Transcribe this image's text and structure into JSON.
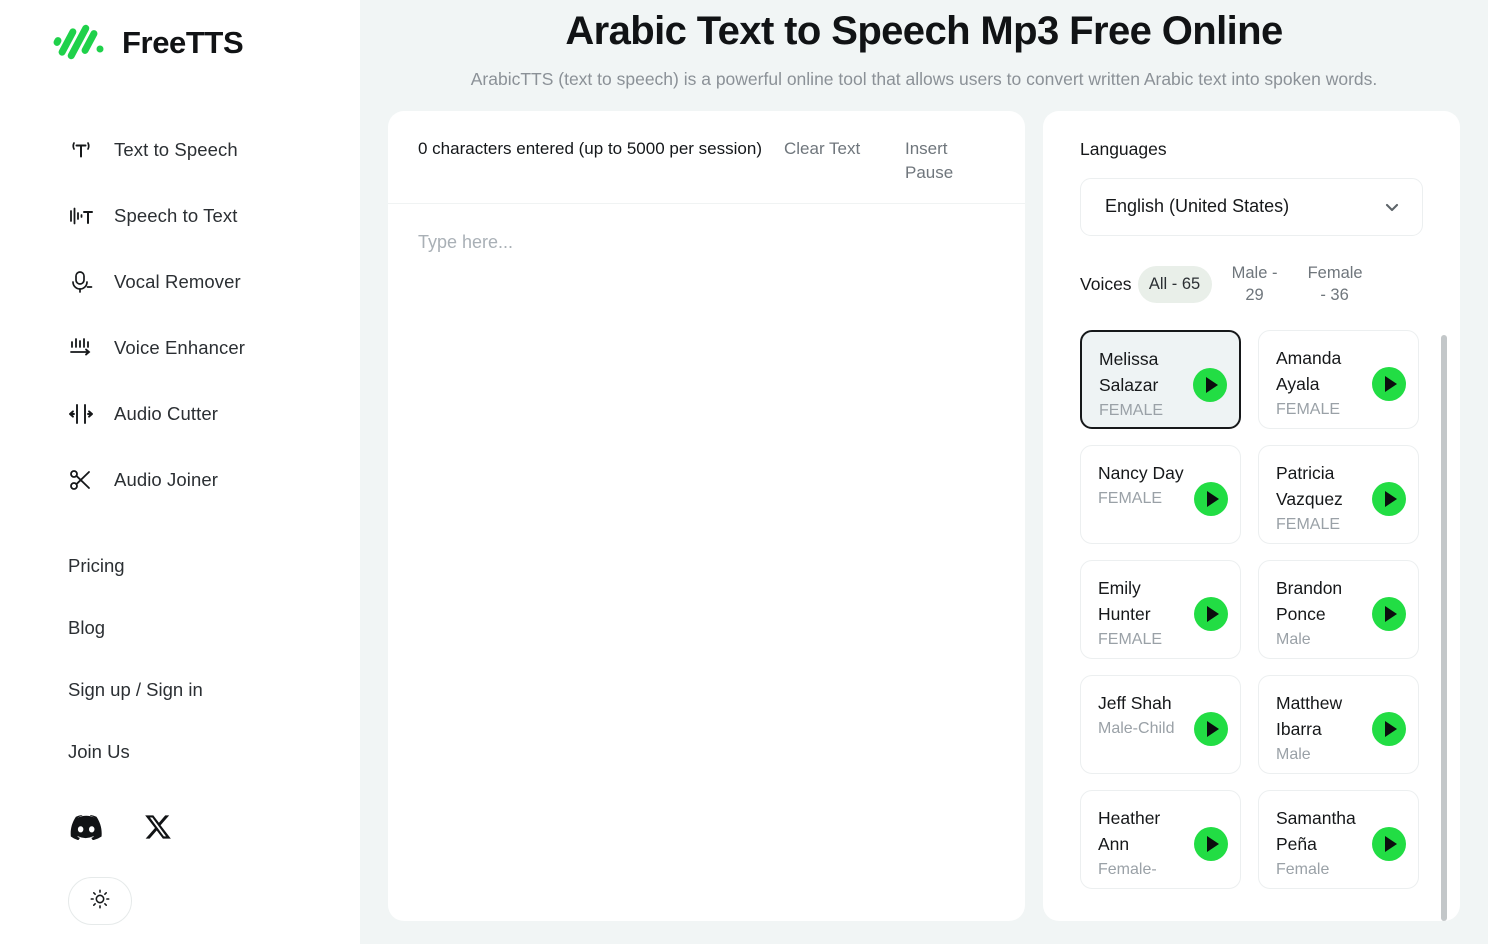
{
  "brand": {
    "name": "FreeTTS",
    "logo_icon": "freetts-waveform-logo",
    "accent_color": "#22c544"
  },
  "sidebar": {
    "nav": [
      {
        "label": "Text to Speech",
        "icon": "text-to-speech-icon"
      },
      {
        "label": "Speech to Text",
        "icon": "speech-to-text-icon"
      },
      {
        "label": "Vocal Remover",
        "icon": "microphone-icon"
      },
      {
        "label": "Voice Enhancer",
        "icon": "voice-enhancer-icon"
      },
      {
        "label": "Audio Cutter",
        "icon": "audio-cutter-icon"
      },
      {
        "label": "Audio Joiner",
        "icon": "scissors-icon"
      }
    ],
    "links": [
      {
        "label": "Pricing"
      },
      {
        "label": "Blog"
      },
      {
        "label": "Sign up / Sign in"
      },
      {
        "label": "Join Us"
      }
    ],
    "socials": [
      {
        "icon": "discord-icon"
      },
      {
        "icon": "x-twitter-icon"
      }
    ],
    "theme_toggle_icon": "sun-icon"
  },
  "header": {
    "title": "Arabic Text to Speech Mp3 Free Online",
    "subtitle": "ArabicTTS (text to speech) is a powerful online tool that allows users to convert written Arabic text into spoken words."
  },
  "editor": {
    "char_count": "0 characters entered (up to 5000 per session)",
    "clear_text": "Clear Text",
    "insert_pause": "Insert Pause",
    "placeholder": "Type here...",
    "value": ""
  },
  "panel": {
    "languages_label": "Languages",
    "language_selected": "English (United States)",
    "voices_label": "Voices",
    "filters": [
      {
        "label": "All - 65",
        "active": true
      },
      {
        "label": "Male - 29",
        "active": false
      },
      {
        "label": "Female - 36",
        "active": false
      }
    ],
    "voices": [
      {
        "name": "Melissa Salazar",
        "gender": "FEMALE",
        "selected": true
      },
      {
        "name": "Amanda Ayala",
        "gender": "FEMALE",
        "selected": false
      },
      {
        "name": "Nancy Day",
        "gender": "FEMALE",
        "selected": false
      },
      {
        "name": "Patricia Vazquez",
        "gender": "FEMALE",
        "selected": false
      },
      {
        "name": "Emily Hunter",
        "gender": "FEMALE",
        "selected": false
      },
      {
        "name": "Brandon Ponce",
        "gender": "Male",
        "selected": false
      },
      {
        "name": "Jeff Shah",
        "gender": "Male-Child",
        "selected": false
      },
      {
        "name": "Matthew Ibarra",
        "gender": "Male",
        "selected": false
      },
      {
        "name": "Heather Ann",
        "gender": "Female-",
        "selected": false
      },
      {
        "name": "Samantha Peña",
        "gender": "Female",
        "selected": false
      }
    ]
  }
}
